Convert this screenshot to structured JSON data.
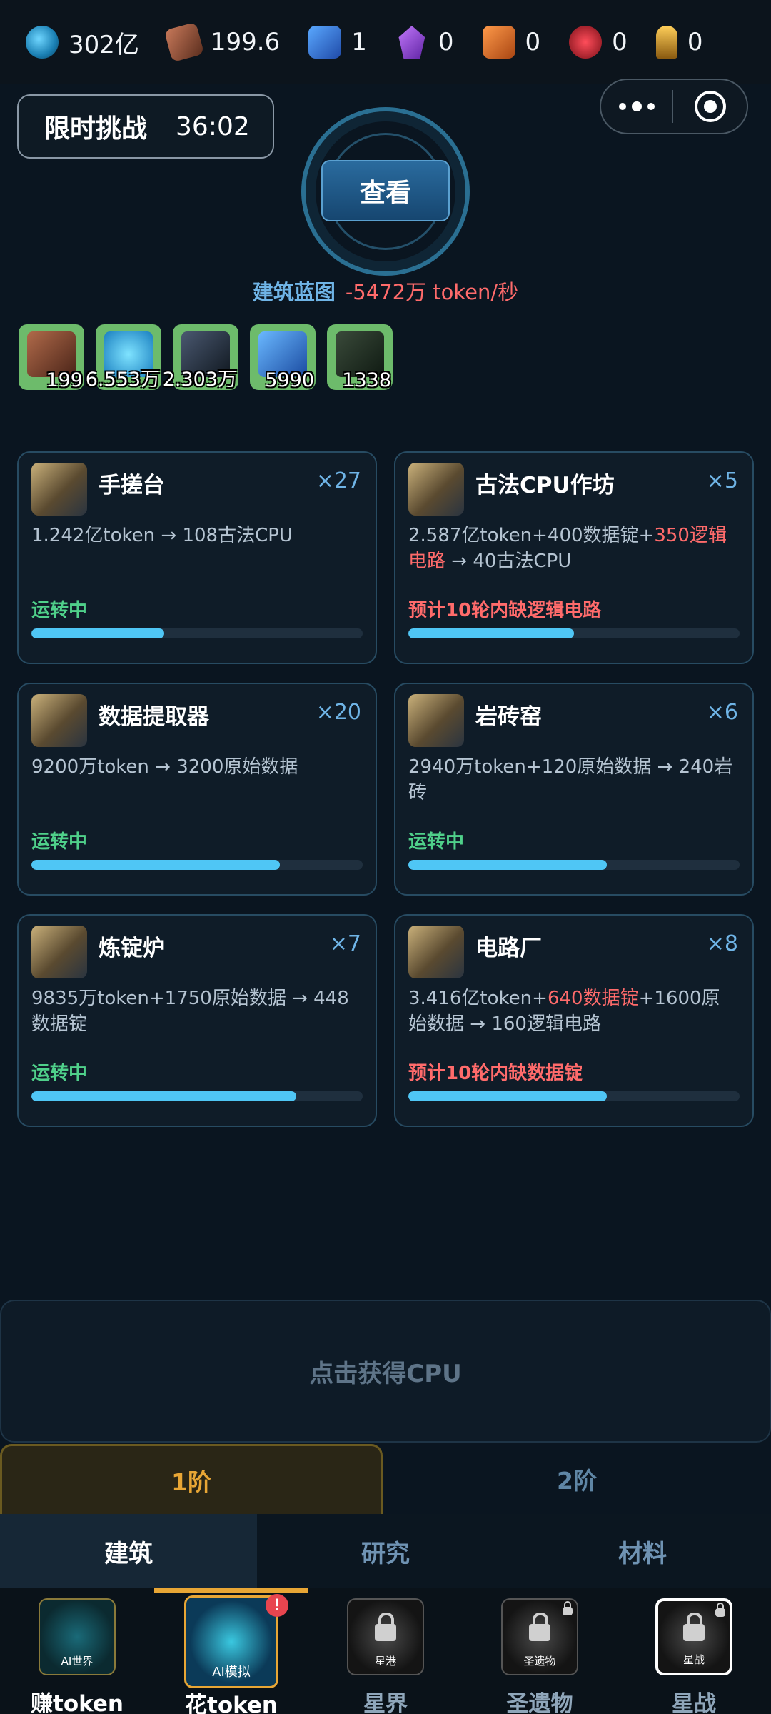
{
  "resources": [
    {
      "icon": "token-coin-icon",
      "value": "302亿"
    },
    {
      "icon": "cpu-chip-icon",
      "value": "199.6"
    },
    {
      "icon": "blue-cube-icon",
      "value": "1"
    },
    {
      "icon": "purple-crystal-icon",
      "value": "0"
    },
    {
      "icon": "orange-brick-icon",
      "value": "0"
    },
    {
      "icon": "red-circuit-icon",
      "value": "0"
    },
    {
      "icon": "golden-key-icon",
      "value": "0"
    }
  ],
  "challenge": {
    "label": "限时挑战",
    "time": "36:02"
  },
  "view_button": "查看",
  "blueprint": {
    "label": "建筑蓝图",
    "rate": "-5472万 token/秒"
  },
  "inventory": [
    "199",
    "6.553万",
    "2.303万",
    "5990",
    "1338"
  ],
  "buildings": [
    {
      "name": "手搓台",
      "count": "×27",
      "recipe_parts": [
        "1.242亿token → 108古法CPU",
        "",
        ""
      ],
      "status": "运转中",
      "progress": 0.4
    },
    {
      "name": "古法CPU作坊",
      "count": "×5",
      "recipe_parts": [
        "2.587亿token+400数据锭+",
        "350逻辑电路",
        " → 40古法CPU"
      ],
      "status": "预计10轮内缺逻辑电路",
      "progress": 0.5
    },
    {
      "name": "数据提取器",
      "count": "×20",
      "recipe_parts": [
        "9200万token → 3200原始数据",
        "",
        ""
      ],
      "status": "运转中",
      "progress": 0.75
    },
    {
      "name": "岩砖窑",
      "count": "×6",
      "recipe_parts": [
        "2940万token+120原始数据 → 240岩砖",
        "",
        ""
      ],
      "status": "运转中",
      "progress": 0.6
    },
    {
      "name": "炼锭炉",
      "count": "×7",
      "recipe_parts": [
        "9835万token+1750原始数据 → 448数据锭",
        "",
        ""
      ],
      "status": "运转中",
      "progress": 0.8
    },
    {
      "name": "电路厂",
      "count": "×8",
      "recipe_parts": [
        "3.416亿token+",
        "640数据锭",
        "+1600原始数据 → 160逻辑电路"
      ],
      "status": "预计10轮内缺数据锭",
      "progress": 0.6
    }
  ],
  "get_cpu": "点击获得CPU",
  "tiers": [
    "1阶",
    "2阶"
  ],
  "categories": [
    "建筑",
    "研究",
    "材料"
  ],
  "nav": [
    {
      "label": "赚token",
      "icon_text": "AI世界"
    },
    {
      "label": "花token",
      "icon_text": "AI模拟",
      "badge": "!"
    },
    {
      "label": "星界",
      "icon_text": "星港"
    },
    {
      "label": "圣遗物",
      "icon_text": "圣遗物"
    },
    {
      "label": "星战",
      "icon_text": "星战"
    }
  ],
  "colors": {
    "accent": "#4fc6f5",
    "running": "#4fd08a",
    "warning": "#ff6b6b",
    "gold": "#e8a635"
  }
}
